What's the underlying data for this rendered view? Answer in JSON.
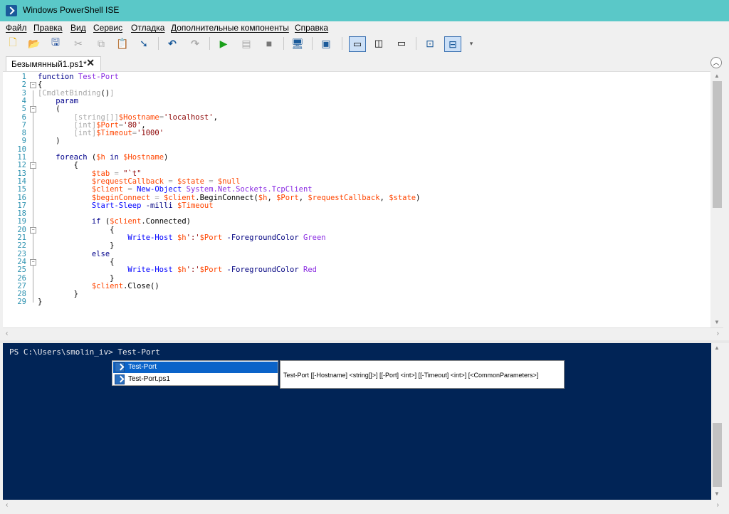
{
  "window": {
    "title": "Windows PowerShell ISE"
  },
  "menu": [
    "Файл",
    "Правка",
    "Вид",
    "Сервис",
    "Отладка",
    "Дополнительные компоненты",
    "Справка"
  ],
  "toolbar": {
    "icons": [
      "new-file-icon",
      "open-folder-icon",
      "save-icon",
      "cut-icon",
      "copy-icon",
      "paste-icon",
      "clear-console-icon",
      "undo-icon",
      "redo-icon",
      "run-script-icon",
      "run-selection-icon",
      "stop-icon",
      "new-remote-tab-icon",
      "start-powershell-icon",
      "show-script-top-icon",
      "show-script-right-icon",
      "show-script-maximized-icon",
      "show-command-window-icon",
      "show-command-addon-icon",
      "overflow-icon"
    ]
  },
  "tab": {
    "label": "Безымянный1.ps1*",
    "close": "✕"
  },
  "editor": {
    "line_numbers": [
      "1",
      "2",
      "3",
      "4",
      "5",
      "6",
      "7",
      "8",
      "9",
      "10",
      "11",
      "12",
      "13",
      "14",
      "15",
      "16",
      "17",
      "18",
      "19",
      "20",
      "21",
      "22",
      "23",
      "24",
      "25",
      "26",
      "27",
      "28",
      "29"
    ],
    "lines": [
      [
        [
          "function ",
          "#00008b"
        ],
        [
          "Test-Port",
          "#8a2be2"
        ]
      ],
      [
        [
          "{",
          "#000"
        ]
      ],
      [
        [
          "[CmdletBinding",
          "#a9a9a9"
        ],
        [
          "()",
          "#000"
        ],
        [
          "]",
          "#a9a9a9"
        ]
      ],
      [
        [
          "    param",
          "#00008b"
        ]
      ],
      [
        [
          "    (",
          "#000"
        ]
      ],
      [
        [
          "        [string[]]",
          "#a9a9a9"
        ],
        [
          "$Hostname",
          "#ff4500"
        ],
        [
          "=",
          "#a9a9a9"
        ],
        [
          "'localhost'",
          "#8b0000"
        ],
        [
          ",",
          "#000"
        ]
      ],
      [
        [
          "        [int]",
          "#a9a9a9"
        ],
        [
          "$Port",
          "#ff4500"
        ],
        [
          "=",
          "#a9a9a9"
        ],
        [
          "'80'",
          "#8b0000"
        ],
        [
          ",",
          "#000"
        ]
      ],
      [
        [
          "        [int]",
          "#a9a9a9"
        ],
        [
          "$Timeout",
          "#ff4500"
        ],
        [
          "=",
          "#a9a9a9"
        ],
        [
          "'1000'",
          "#8b0000"
        ]
      ],
      [
        [
          "    )",
          "#000"
        ]
      ],
      [
        [
          "",
          "#000"
        ]
      ],
      [
        [
          "    foreach ",
          "#00008b"
        ],
        [
          "(",
          "#000"
        ],
        [
          "$h",
          "#ff4500"
        ],
        [
          " in ",
          "#00008b"
        ],
        [
          "$Hostname",
          "#ff4500"
        ],
        [
          ")",
          "#000"
        ]
      ],
      [
        [
          "        {",
          "#000"
        ]
      ],
      [
        [
          "            $tab",
          "#ff4500"
        ],
        [
          " = ",
          "#a9a9a9"
        ],
        [
          "\"`t\"",
          "#8b0000"
        ]
      ],
      [
        [
          "            $requestCallback",
          "#ff4500"
        ],
        [
          " = ",
          "#a9a9a9"
        ],
        [
          "$state",
          "#ff4500"
        ],
        [
          " = ",
          "#a9a9a9"
        ],
        [
          "$null",
          "#ff4500"
        ]
      ],
      [
        [
          "            $client",
          "#ff4500"
        ],
        [
          " = ",
          "#a9a9a9"
        ],
        [
          "New-Object ",
          "#0000ff"
        ],
        [
          "System.Net.Sockets.TcpClient",
          "#8a2be2"
        ]
      ],
      [
        [
          "            $beginConnect",
          "#ff4500"
        ],
        [
          " = ",
          "#a9a9a9"
        ],
        [
          "$client",
          "#ff4500"
        ],
        [
          ".BeginConnect(",
          "#000"
        ],
        [
          "$h",
          "#ff4500"
        ],
        [
          ", ",
          "#000"
        ],
        [
          "$Port",
          "#ff4500"
        ],
        [
          ", ",
          "#000"
        ],
        [
          "$requestCallback",
          "#ff4500"
        ],
        [
          ", ",
          "#000"
        ],
        [
          "$state",
          "#ff4500"
        ],
        [
          ")",
          "#000"
        ]
      ],
      [
        [
          "            Start-Sleep ",
          "#0000ff"
        ],
        [
          "-milli ",
          "#000080"
        ],
        [
          "$Timeout",
          "#ff4500"
        ]
      ],
      [
        [
          "",
          "#000"
        ]
      ],
      [
        [
          "            if ",
          "#00008b"
        ],
        [
          "(",
          "#000"
        ],
        [
          "$client",
          "#ff4500"
        ],
        [
          ".Connected)",
          "#000"
        ]
      ],
      [
        [
          "                {",
          "#000"
        ]
      ],
      [
        [
          "                    Write-Host ",
          "#0000ff"
        ],
        [
          "$h",
          "#ff4500"
        ],
        [
          "':'",
          "#8b0000"
        ],
        [
          "$Port",
          "#ff4500"
        ],
        [
          " -ForegroundColor ",
          "#000080"
        ],
        [
          "Green",
          "#8a2be2"
        ]
      ],
      [
        [
          "                }",
          "#000"
        ]
      ],
      [
        [
          "            else",
          "#00008b"
        ]
      ],
      [
        [
          "                {",
          "#000"
        ]
      ],
      [
        [
          "                    Write-Host ",
          "#0000ff"
        ],
        [
          "$h",
          "#ff4500"
        ],
        [
          "':'",
          "#8b0000"
        ],
        [
          "$Port",
          "#ff4500"
        ],
        [
          " -ForegroundColor ",
          "#000080"
        ],
        [
          "Red",
          "#8a2be2"
        ]
      ],
      [
        [
          "                }",
          "#000"
        ]
      ],
      [
        [
          "            $client",
          "#ff4500"
        ],
        [
          ".Close()",
          "#000"
        ]
      ],
      [
        [
          "        }",
          "#000"
        ]
      ],
      [
        [
          "}",
          "#000"
        ]
      ]
    ]
  },
  "console": {
    "prompt": "PS C:\\Users\\smolin_iv> Test-Port",
    "autocomplete": [
      "Test-Port",
      "Test-Port.ps1"
    ],
    "tooltip": "Test-Port [[-Hostname] <string[]>] [[-Port] <int>] [[-Timeout] <int>] [<CommonParameters>]"
  },
  "colors": {
    "titlebar": "#5ac8c8",
    "console_bg": "#012456",
    "selection": "#0a63c9"
  }
}
